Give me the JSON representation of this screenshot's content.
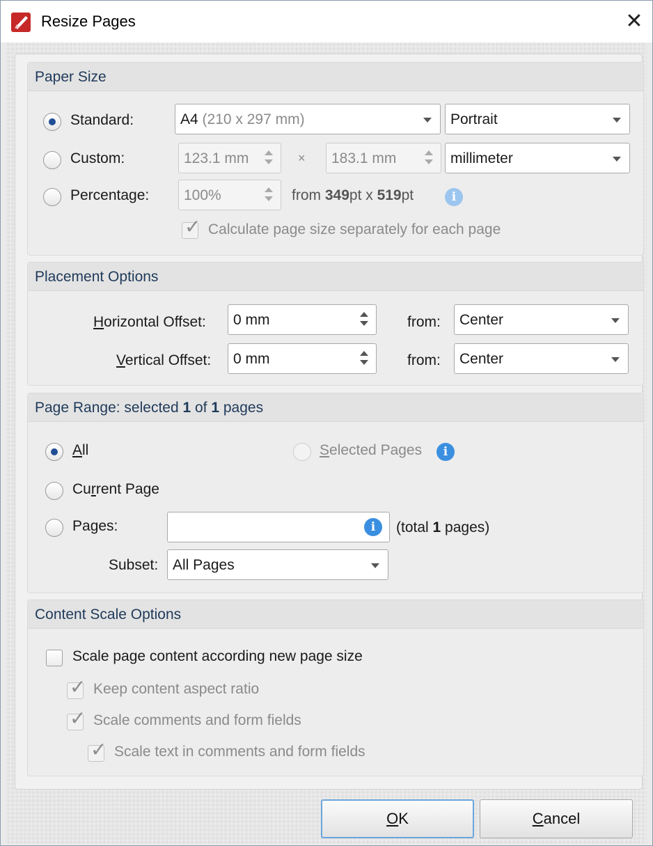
{
  "window": {
    "title": "Resize Pages",
    "close_glyph": "✕",
    "icon": "pdf-app-icon"
  },
  "paper_size": {
    "title": "Paper Size",
    "standard_label": "Standard:",
    "custom_label": "Custom:",
    "percentage_label": "Percentage:",
    "standard_size_bold": "A4",
    "standard_size_rest": " (210 x 297 mm)",
    "orientation": "Portrait",
    "custom_width": "123.1 mm",
    "times": "×",
    "custom_height": "183.1 mm",
    "unit": "millimeter",
    "percentage_value": "100%",
    "from_prefix": "from ",
    "from_w": "349",
    "from_pt1": "pt x ",
    "from_h": "519",
    "from_pt2": "pt",
    "calc_separately": "Calculate page size separately for each page"
  },
  "placement": {
    "title": "Placement Options",
    "h_offset_label_u": "H",
    "h_offset_label_rest": "orizontal Offset:",
    "v_offset_label_u": "V",
    "v_offset_label_rest": "ertical Offset:",
    "h_offset_value": "0 mm",
    "v_offset_value": "0 mm",
    "from_label": "from:",
    "h_from": "Center",
    "v_from": "Center"
  },
  "page_range": {
    "title_prefix": "Page Range: selected ",
    "selected": "1",
    "of": " of ",
    "total": "1",
    "title_suffix": " pages",
    "all_u": "A",
    "all_rest": "ll",
    "selected_pages_u": "S",
    "selected_pages_rest": "elected Pages",
    "current_page_pre": "Cu",
    "current_page_u": "r",
    "current_page_rest": "rent Page",
    "pages_pre": "Pa",
    "pages_u": "g",
    "pages_rest": "es:",
    "pages_value": "",
    "total_prefix": "(total ",
    "total_count": "1",
    "total_suffix": " pages)",
    "subset_label": "Subset:",
    "subset_value": "All Pages"
  },
  "content_scale": {
    "title": "Content Scale Options",
    "scale_content": "Scale page content according new page size",
    "keep_aspect": "Keep content aspect ratio",
    "scale_comments": "Scale comments and form fields",
    "scale_text": "Scale text in comments and form fields"
  },
  "buttons": {
    "ok_u": "O",
    "ok_rest": "K",
    "cancel_u": "C",
    "cancel_rest": "ancel"
  }
}
